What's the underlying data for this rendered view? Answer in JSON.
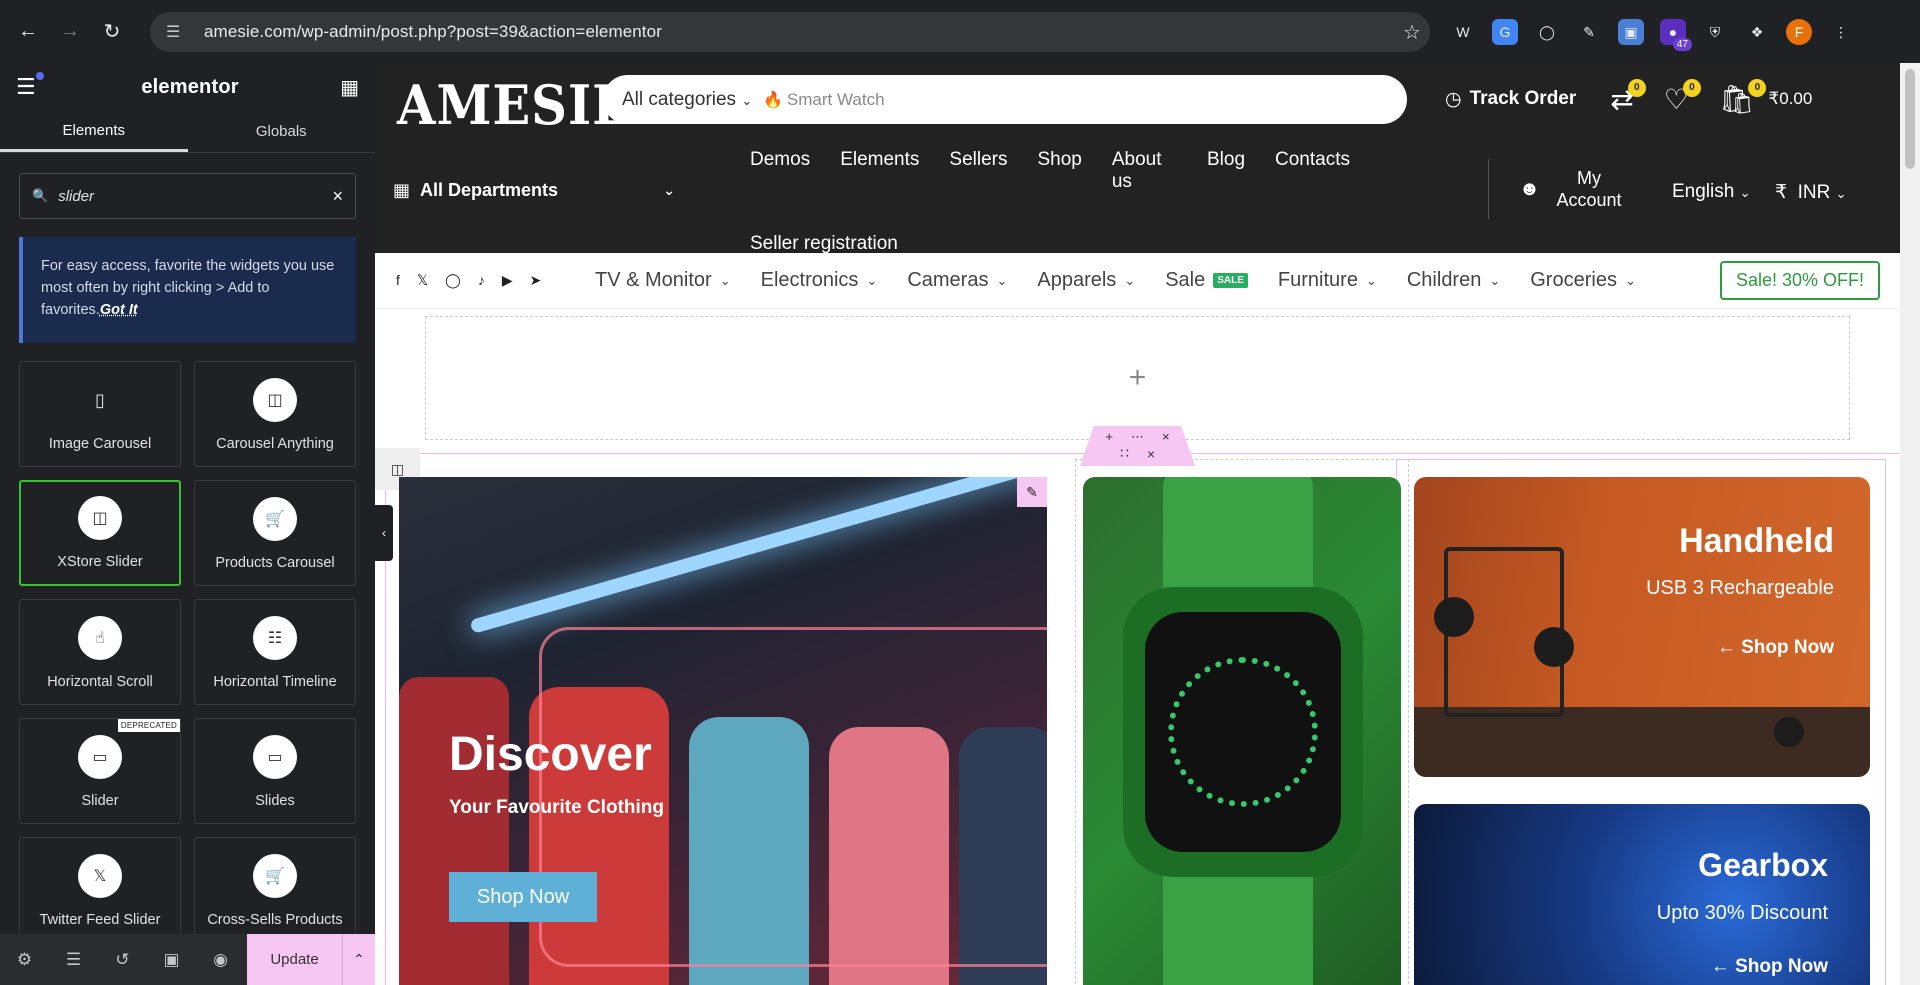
{
  "browser": {
    "url": "amesie.com/wp-admin/post.php?post=39&action=elementor",
    "ext_badge_count": "47",
    "profile_initial": "F"
  },
  "panel": {
    "brand": "elementor",
    "tabs": [
      "Elements",
      "Globals"
    ],
    "search_value": "slider",
    "tip_text": "For easy access, favorite the widgets you use most often by right clicking > Add to favorites.",
    "tip_link": "Got It",
    "widgets": [
      {
        "label": "Image Carousel",
        "icon": "image-carousel-icon"
      },
      {
        "label": "Carousel Anything",
        "icon": "carousel-icon"
      },
      {
        "label": "XStore Slider",
        "icon": "carousel-icon"
      },
      {
        "label": "Products Carousel",
        "icon": "cart-icon"
      },
      {
        "label": "Horizontal Scroll",
        "icon": "hand-pointer-icon"
      },
      {
        "label": "Horizontal Timeline",
        "icon": "timeline-icon"
      },
      {
        "label": "Slider",
        "icon": "slider-icon",
        "badge": "DEPRECATED"
      },
      {
        "label": "Slides",
        "icon": "slides-icon"
      },
      {
        "label": "Twitter Feed Slider",
        "icon": "x-icon"
      },
      {
        "label": "Cross-Sells Products",
        "icon": "cart-icon"
      }
    ],
    "update_label": "Update"
  },
  "site": {
    "logo": "AMESIE",
    "search": {
      "category": "All categories",
      "placeholder": "Smart Watch"
    },
    "track_order": "Track Order",
    "compare_count": "0",
    "wishlist_count": "0",
    "cart_count": "0",
    "cart_total": "₹0.00",
    "all_departments": "All Departments",
    "menu": [
      "Demos",
      "Elements",
      "Sellers",
      "Shop",
      "About us",
      "Blog",
      "Contacts"
    ],
    "menu_row2": "Seller registration",
    "account": "My Account",
    "language": "English",
    "currency_symbol": "₹",
    "currency": "INR",
    "categories": [
      "TV & Monitor",
      "Electronics",
      "Cameras",
      "Apparels",
      "Sale",
      "Furniture",
      "Children",
      "Groceries"
    ],
    "sale_badge": "SALE",
    "sale_button": "Sale! 30% OFF!",
    "hero_main": {
      "title": "Discover",
      "subtitle": "Your Favourite Clothing",
      "button": "Shop Now"
    },
    "banner_handheld": {
      "title": "Handheld",
      "subtitle": "USB 3 Rechargeable",
      "link": "← Shop Now"
    },
    "banner_gearbox": {
      "title": "Gearbox",
      "subtitle": "Upto 30% Discount",
      "link": "← Shop Now"
    }
  },
  "colors": {
    "accent_selected": "#39c132",
    "elementor_pink": "#f6c7f2",
    "sale_green": "#2c9a3e"
  }
}
